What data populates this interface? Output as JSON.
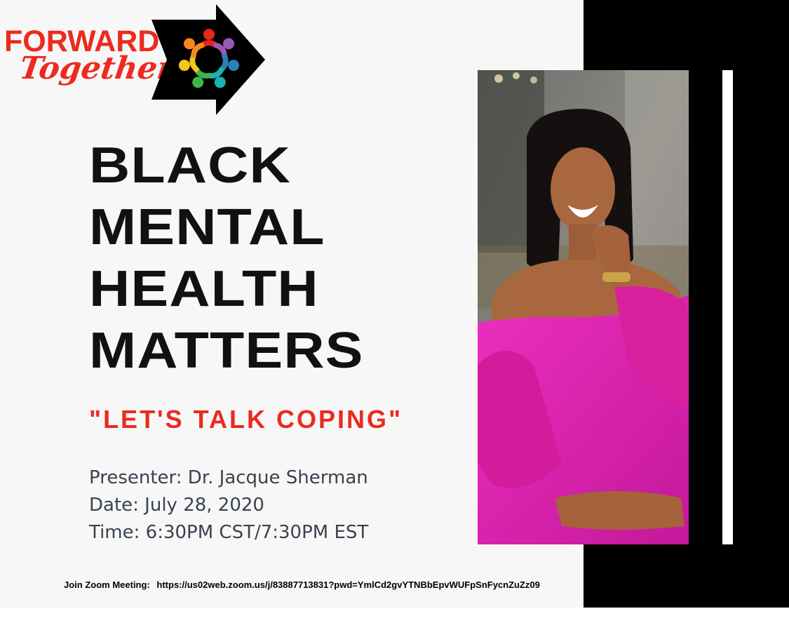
{
  "logo": {
    "word1": "FORWARD",
    "word2": "Together",
    "brand_color": "#ec2a1d",
    "icon": "circle-of-people-arrow-icon"
  },
  "headline": [
    "BLACK",
    "MENTAL",
    "HEALTH",
    "MATTERS"
  ],
  "subheadline": "\"LET'S TALK COPING\"",
  "details": {
    "presenter": "Presenter: Dr. Jacque Sherman",
    "date": "Date: July 28, 2020",
    "time": "Time: 6:30PM CST/7:30PM EST"
  },
  "footer": {
    "label": "Join Zoom Meeting:",
    "url": "https://us02web.zoom.us/j/83887713831?pwd=YmlCd2gvYTNBbEpvWUFpSnFycnZuZz09"
  },
  "photo": {
    "icon": "presenter-portrait",
    "dress_color": "#e21fb0"
  },
  "colors": {
    "accent_red": "#ec2a1d",
    "text_dark": "#111111",
    "info_text": "#3a4250",
    "panel_black": "#000000"
  }
}
